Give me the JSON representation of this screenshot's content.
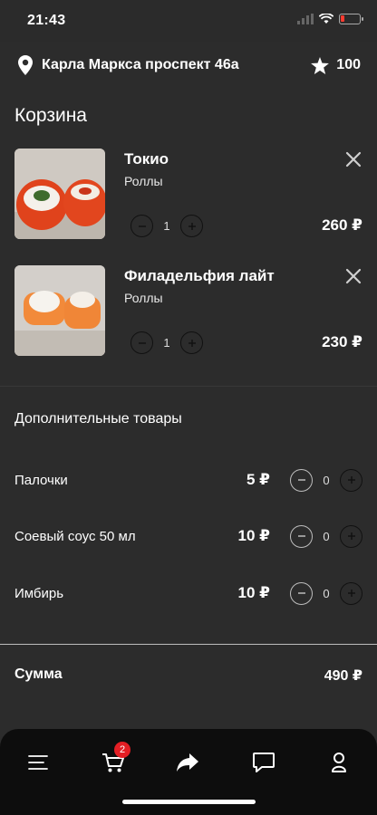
{
  "status": {
    "time": "21:43"
  },
  "header": {
    "address": "Карла Маркса проспект 46а",
    "points": "100"
  },
  "title": "Корзина",
  "cart": [
    {
      "name": "Токио",
      "category": "Роллы",
      "qty": "1",
      "price": "260 ₽"
    },
    {
      "name": "Филадельфия лайт",
      "category": "Роллы",
      "qty": "1",
      "price": "230 ₽"
    }
  ],
  "extras": {
    "title": "Дополнительные товары",
    "items": [
      {
        "name": "Палочки",
        "price": "5 ₽",
        "qty": "0"
      },
      {
        "name": "Соевый соус 50 мл",
        "price": "10 ₽",
        "qty": "0"
      },
      {
        "name": "Имбирь",
        "price": "10 ₽",
        "qty": "0"
      }
    ]
  },
  "summary": {
    "label": "Сумма",
    "value": "490 ₽"
  },
  "nav": {
    "cart_badge": "2"
  },
  "colors": {
    "background": "#2c2c2c",
    "nav": "#0d0d0d",
    "badge": "#e31e24",
    "battery": "#ff3b30"
  }
}
